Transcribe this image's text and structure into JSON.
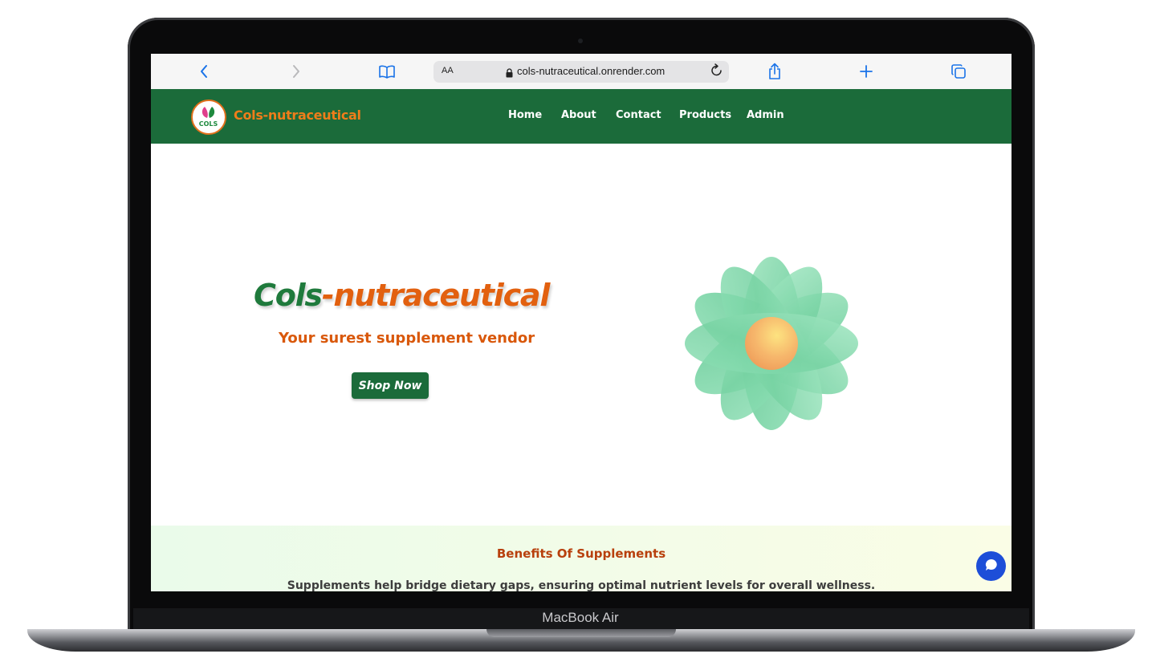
{
  "device": {
    "label": "MacBook Air"
  },
  "browser": {
    "text_size_label": "AA",
    "url": "cols-nutraceutical.onrender.com",
    "icons": [
      "back-icon",
      "forward-icon",
      "bookmarks-icon",
      "lock-icon",
      "reload-icon",
      "share-icon",
      "new-tab-icon",
      "tabs-icon"
    ],
    "accent": "#1a73e8"
  },
  "nav": {
    "brand": "Cols-nutraceutical",
    "logo_text": "COLS",
    "links": [
      "Home",
      "About",
      "Contact",
      "Products",
      "Admin"
    ],
    "bg_color": "#1b6b3a",
    "brand_color": "#ef7d1a"
  },
  "hero": {
    "title_part1": "Cols",
    "title_part2": "-nutraceutical",
    "tagline": "Your surest supplement vendor",
    "cta": "Shop Now"
  },
  "benefits": {
    "title": "Benefits Of Supplements",
    "text": "Supplements help bridge dietary gaps, ensuring optimal nutrient levels for overall wellness."
  },
  "chat": {
    "icon": "chat-icon",
    "color": "#1d4ed8"
  }
}
